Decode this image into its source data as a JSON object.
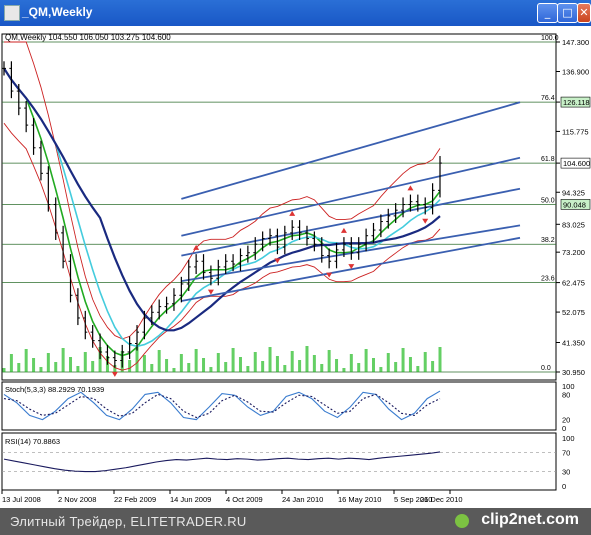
{
  "window": {
    "title": "_QM,Weekly",
    "min_glyph": "_",
    "max_glyph": "□",
    "close_glyph": "✕"
  },
  "colors": {
    "price": "#000000",
    "upper_channel": "#3a5fb0",
    "ma_green": "#22aa22",
    "ma_cyan": "#44ccdd",
    "ma_navy": "#1a2a80",
    "envelope": "#cc2222",
    "fractal": "#dd3333",
    "fib_line": "#2c6e2c",
    "stoch_main": "#3a7ccf",
    "stoch_signal": "#1a1a5e",
    "rsi": "#1a1a5e",
    "volume": "#22bb22",
    "label_bg_green": "#c8f0c8"
  },
  "chart_data": {
    "type": "line",
    "symbol_header": "QM,Weekly  104.550 106.050 103.275 104.600",
    "price_axis": {
      "ticks": [
        "147.300",
        "136.900",
        "126.115",
        "115.775",
        "104.600",
        "94.325",
        "83.025",
        "73.200",
        "62.475",
        "52.075",
        "41.350",
        "30.950"
      ],
      "ylim": [
        30.95,
        147.3
      ]
    },
    "highlight_labels": [
      {
        "value": "126.118",
        "style": "green"
      },
      {
        "value": "104.600",
        "style": "white"
      },
      {
        "value": "90.048",
        "style": "green"
      }
    ],
    "fibonacci_levels": [
      {
        "label": "100.0",
        "price": 147.3
      },
      {
        "label": "76.4",
        "price": 126.1
      },
      {
        "label": "61.8",
        "price": 104.6
      },
      {
        "label": "50.0",
        "price": 90.0
      },
      {
        "label": "38.2",
        "price": 76.0
      },
      {
        "label": "23.6",
        "price": 62.5
      },
      {
        "label": "0.0",
        "price": 30.95
      }
    ],
    "dates": [
      "13 Jul 2008",
      "2 Nov 2008",
      "22 Feb 2009",
      "14 Jun 2009",
      "4 Oct 2009",
      "24 Jan 2010",
      "16 May 2010",
      "5 Sep 2010",
      "26 Dec 2010"
    ],
    "close": [
      {
        "i": 0,
        "v": 138
      },
      {
        "i": 1,
        "v": 130
      },
      {
        "i": 2,
        "v": 124
      },
      {
        "i": 3,
        "v": 118
      },
      {
        "i": 4,
        "v": 110
      },
      {
        "i": 5,
        "v": 101
      },
      {
        "i": 6,
        "v": 90
      },
      {
        "i": 7,
        "v": 80
      },
      {
        "i": 8,
        "v": 70
      },
      {
        "i": 9,
        "v": 58
      },
      {
        "i": 10,
        "v": 50
      },
      {
        "i": 11,
        "v": 45
      },
      {
        "i": 12,
        "v": 42
      },
      {
        "i": 13,
        "v": 38
      },
      {
        "i": 14,
        "v": 36
      },
      {
        "i": 15,
        "v": 35
      },
      {
        "i": 16,
        "v": 38
      },
      {
        "i": 17,
        "v": 41
      },
      {
        "i": 18,
        "v": 45
      },
      {
        "i": 19,
        "v": 50
      },
      {
        "i": 20,
        "v": 52
      },
      {
        "i": 21,
        "v": 54
      },
      {
        "i": 22,
        "v": 55
      },
      {
        "i": 23,
        "v": 58
      },
      {
        "i": 24,
        "v": 62
      },
      {
        "i": 25,
        "v": 68
      },
      {
        "i": 26,
        "v": 70
      },
      {
        "i": 27,
        "v": 66
      },
      {
        "i": 28,
        "v": 64
      },
      {
        "i": 29,
        "v": 68
      },
      {
        "i": 30,
        "v": 70
      },
      {
        "i": 31,
        "v": 69
      },
      {
        "i": 32,
        "v": 72
      },
      {
        "i": 33,
        "v": 73
      },
      {
        "i": 34,
        "v": 76
      },
      {
        "i": 35,
        "v": 78
      },
      {
        "i": 36,
        "v": 79
      },
      {
        "i": 37,
        "v": 75
      },
      {
        "i": 38,
        "v": 80
      },
      {
        "i": 39,
        "v": 82
      },
      {
        "i": 40,
        "v": 80
      },
      {
        "i": 41,
        "v": 78
      },
      {
        "i": 42,
        "v": 76
      },
      {
        "i": 43,
        "v": 72
      },
      {
        "i": 44,
        "v": 70
      },
      {
        "i": 45,
        "v": 74
      },
      {
        "i": 46,
        "v": 76
      },
      {
        "i": 47,
        "v": 73
      },
      {
        "i": 48,
        "v": 76
      },
      {
        "i": 49,
        "v": 79
      },
      {
        "i": 50,
        "v": 81
      },
      {
        "i": 51,
        "v": 84
      },
      {
        "i": 52,
        "v": 86
      },
      {
        "i": 53,
        "v": 88
      },
      {
        "i": 54,
        "v": 90
      },
      {
        "i": 55,
        "v": 91
      },
      {
        "i": 56,
        "v": 90
      },
      {
        "i": 57,
        "v": 89
      },
      {
        "i": 58,
        "v": 95
      },
      {
        "i": 59,
        "v": 104.6
      }
    ],
    "volume_note": "",
    "stochastic": {
      "label": "Stoch(5,3,3) 88.2929 70.1939",
      "levels": [
        "100",
        "80",
        "20",
        "0"
      ],
      "main": [
        80,
        60,
        30,
        20,
        40,
        70,
        85,
        60,
        30,
        20,
        45,
        80,
        85,
        60,
        25,
        20,
        50,
        82,
        78,
        50,
        30,
        40,
        75,
        85,
        70,
        40,
        25,
        50,
        85,
        80,
        45,
        20,
        35,
        70,
        88
      ],
      "signal": [
        70,
        65,
        45,
        30,
        35,
        55,
        75,
        70,
        45,
        28,
        35,
        60,
        80,
        70,
        40,
        25,
        35,
        65,
        78,
        62,
        40,
        38,
        60,
        78,
        75,
        55,
        35,
        40,
        70,
        80,
        60,
        35,
        30,
        55,
        70
      ]
    },
    "rsi": {
      "label": "RSI(14) 70.8863",
      "levels": [
        "100",
        "70",
        "30",
        "0"
      ],
      "values": [
        56,
        52,
        48,
        44,
        40,
        36,
        33,
        31,
        30,
        30,
        32,
        35,
        38,
        42,
        46,
        50,
        53,
        55,
        54,
        56,
        58,
        56,
        55,
        57,
        56,
        54,
        55,
        57,
        58,
        56,
        55,
        57,
        58,
        56,
        58,
        57,
        55,
        58,
        60,
        62,
        64,
        66,
        68,
        70.9
      ]
    }
  },
  "footer": {
    "left_text": "Элитный Трейдер, ELITETRADER.RU",
    "brand": "clip2net.com"
  }
}
